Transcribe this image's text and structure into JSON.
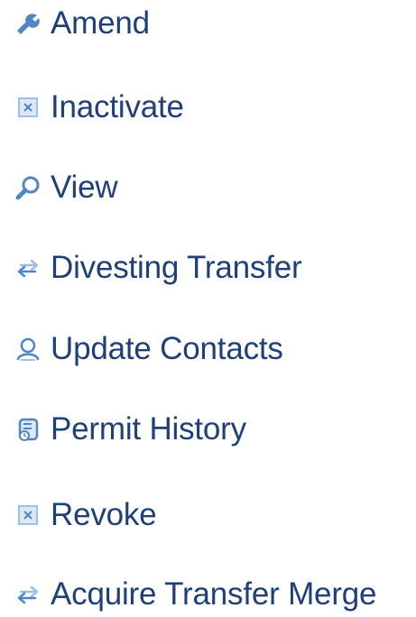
{
  "menu": {
    "items": [
      {
        "label": "Amend",
        "icon": "wrench-icon"
      },
      {
        "label": "Inactivate",
        "icon": "close-box-icon"
      },
      {
        "label": "View",
        "icon": "magnifier-icon"
      },
      {
        "label": "Divesting Transfer",
        "icon": "transfer-arrows-icon"
      },
      {
        "label": "Update Contacts",
        "icon": "contact-icon"
      },
      {
        "label": "Permit History",
        "icon": "history-document-icon"
      },
      {
        "label": "Revoke",
        "icon": "close-box-icon"
      },
      {
        "label": "Acquire Transfer Merge",
        "icon": "transfer-arrows-icon"
      }
    ]
  },
  "colors": {
    "text": "#1f3f78",
    "icon_blue": "#4f86c5",
    "icon_light_blue": "#9ebee4",
    "background": "#ffffff"
  }
}
